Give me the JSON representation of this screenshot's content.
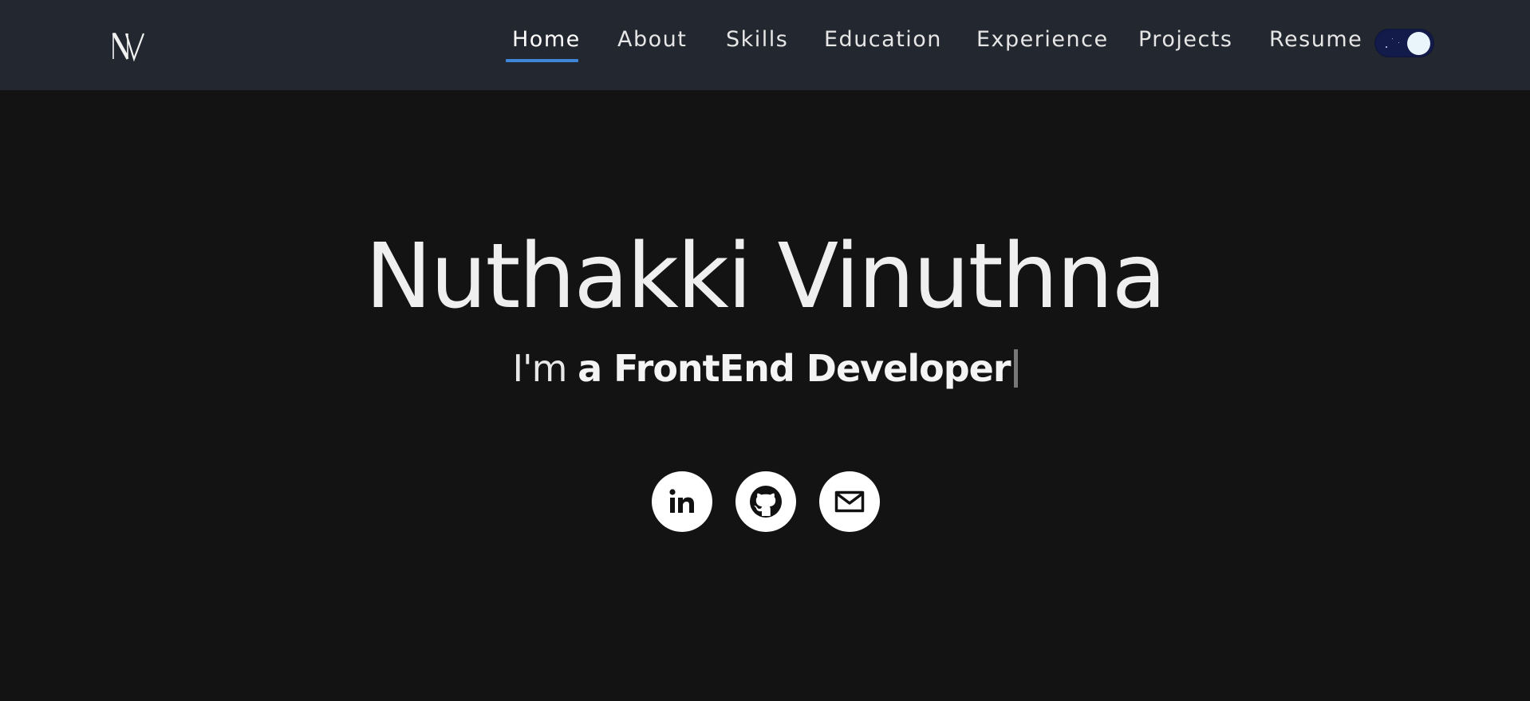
{
  "nav": {
    "logo_text": "NV",
    "links": [
      {
        "label": "Home",
        "active": true
      },
      {
        "label": "About",
        "active": false
      },
      {
        "label": "Skills",
        "active": false
      },
      {
        "label": "Education",
        "active": false
      },
      {
        "label": "Experience",
        "active": false
      },
      {
        "label": "Projects",
        "active": false
      },
      {
        "label": "Resume",
        "active": false
      }
    ],
    "theme_toggle": {
      "state": "dark",
      "icon": "moon-stars-toggle"
    },
    "accent_color": "#3d86d8"
  },
  "hero": {
    "name": "Nuthakki Vinuthna",
    "prefix": "I'm ",
    "role": "a FrontEnd Developer"
  },
  "socials": [
    {
      "name": "LinkedIn",
      "icon": "linkedin-icon"
    },
    {
      "name": "GitHub",
      "icon": "github-icon"
    },
    {
      "name": "Email",
      "icon": "mail-icon"
    }
  ],
  "colors": {
    "navbar_bg": "#23272f",
    "page_bg": "#131313",
    "text": "#efefef"
  }
}
